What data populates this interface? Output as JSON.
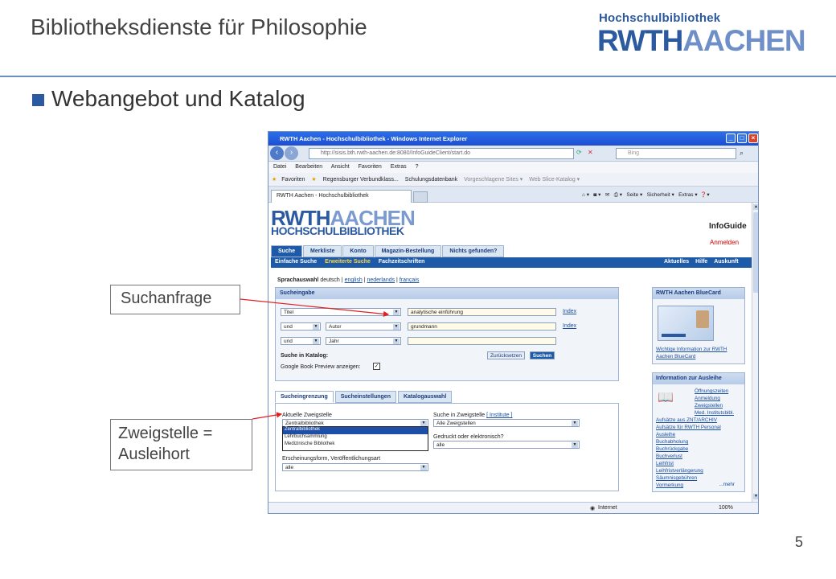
{
  "slide": {
    "title": "Bibliotheksdienste für Philosophie",
    "logo_small": "Hochschulbibliothek",
    "logo_part1": "RWTH",
    "logo_part2": "AACHEN",
    "bullet": "Webangebot und Katalog",
    "page_number": "5",
    "callout1": "Suchanfrage",
    "callout2_line1": "Zweigstelle =",
    "callout2_line2": "Ausleihort"
  },
  "browser": {
    "window_title": "RWTH Aachen - Hochschulbibliothek - Windows Internet Explorer",
    "url": "http://sisis.bth.rwth-aachen.de:8080/InfoGuideClient/start.do",
    "search_provider": "Bing",
    "menu": [
      "Datei",
      "Bearbeiten",
      "Ansicht",
      "Favoriten",
      "Extras",
      "?"
    ],
    "favorites_label": "Favoriten",
    "favorites_items": [
      "Regensburger Verbundklass...",
      "Schulungsdatenbank",
      "Vorgeschlagene Sites ▾",
      "Web Slice-Katalog ▾"
    ],
    "tab_title": "RWTH Aachen - Hochschulbibliothek",
    "tools": [
      "Seite ▾",
      "Sicherheit ▾",
      "Extras ▾"
    ],
    "status_zone": "Internet",
    "zoom": "100%"
  },
  "site": {
    "logo_line1_a": "RWTH",
    "logo_line1_b": "AACHEN",
    "logo_line2": "HOCHSCHULBIBLIOTHEK",
    "brand": "InfoGuide",
    "login": "Anmelden",
    "tabs": [
      "Suche",
      "Merkliste",
      "Konto",
      "Magazin-Bestellung",
      "Nichts gefunden?"
    ],
    "subnav": [
      "Einfache Suche",
      "Erweiterte Suche",
      "Fachzeitschriften"
    ],
    "subnav_right": [
      "Aktuelles",
      "Hilfe",
      "Auskunft"
    ],
    "lang_label": "Sprachauswahl",
    "lang_current": "deutsch",
    "lang_links": [
      "english",
      "nederlands",
      "français"
    ],
    "search": {
      "header": "Sucheingabe",
      "row1_field": "Titel",
      "row1_value": "analytische einführung",
      "row2_op": "und",
      "row2_field": "Autor",
      "row2_value": "grundmann",
      "row3_op": "und",
      "row3_field": "Jahr",
      "row3_value": "",
      "index_label": "Index",
      "catalog_label": "Suche in Katalog:",
      "reset_button": "Zurücksetzen",
      "search_button": "Suchen",
      "google_label": "Google Book Preview anzeigen:",
      "google_checked": "✓"
    },
    "filter_tabs": [
      "Sucheingrenzung",
      "Sucheinstellungen",
      "Katalogauswahl"
    ],
    "filter": {
      "branch_label": "Aktuelle Zweigstelle",
      "branch_value": "Zentralbibliothek",
      "branch_options": [
        "Zentralbibliothek",
        "Lehrbuchsammlung",
        "Medizinische Bibliothek"
      ],
      "search_in_label": "Suche in Zweigstelle",
      "institute_link": "[ Institute ]",
      "search_in_value": "Alle Zweigstellen",
      "print_label": "Gedruckt oder elektronisch?",
      "print_value": "alle",
      "form_label": "Erscheinungsform, Veröffentlichungsart",
      "form_value": "alle"
    },
    "bluecard": {
      "header": "RWTH Aachen BlueCard",
      "link": "Wichtige Information zur RWTH Aachen BlueCard"
    },
    "loan": {
      "header": "Information zur Ausleihe",
      "links_top": [
        "Öffnungszeiten",
        "Anmeldung",
        "Zweigstellen",
        "Med. Institutsbibl."
      ],
      "links": [
        "Aufsätze aus ZNT/ARCHIV",
        "Aufsätze für RWTH Personal",
        "Ausleihe",
        "Buchabholung",
        "Buchrückgabe",
        "Buchverlust",
        "Leihfrist",
        "Leihfristverlängerung",
        "Säumnisgebühren",
        "Vormerkung"
      ],
      "more": "...mehr"
    }
  }
}
